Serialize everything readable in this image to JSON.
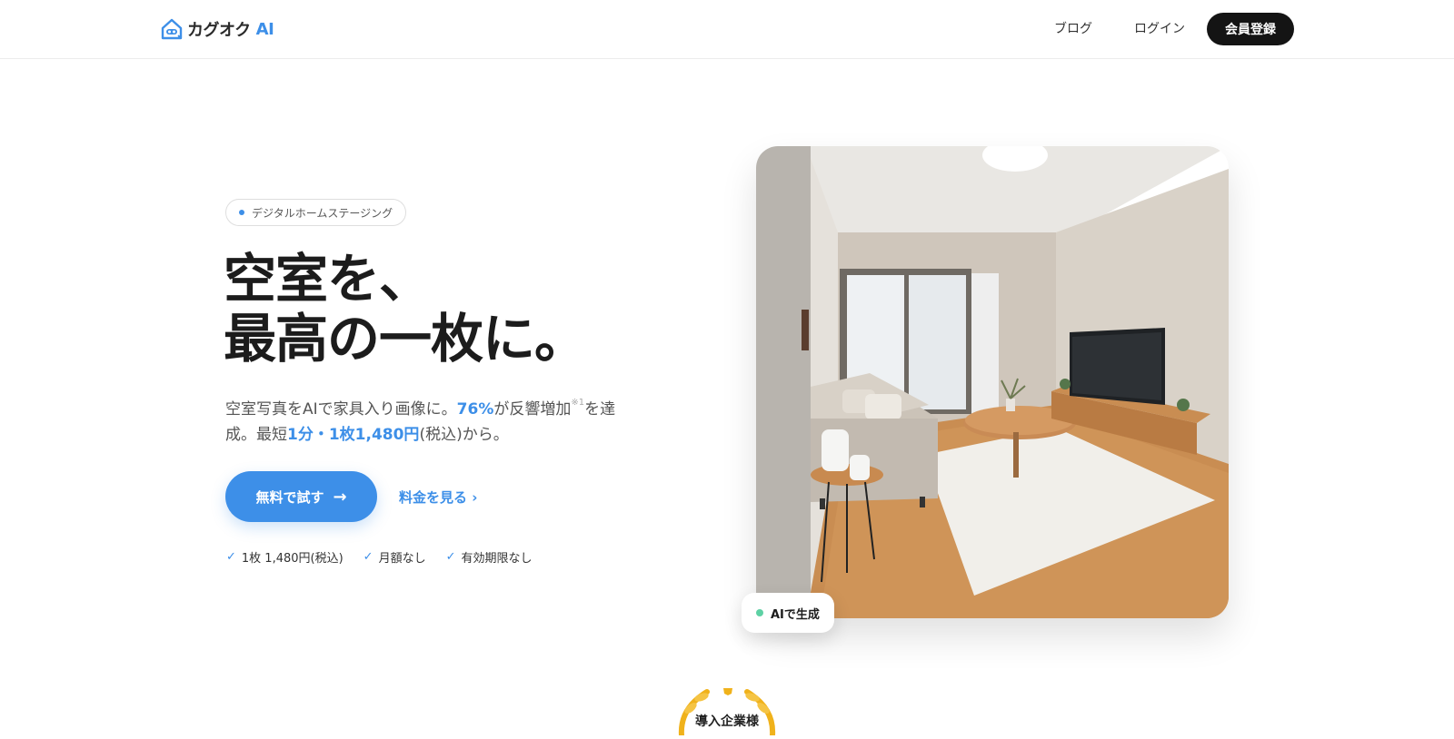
{
  "header": {
    "logo_text": "カグオク",
    "logo_ai": "AI",
    "nav": {
      "blog": "ブログ",
      "login": "ログイン",
      "signup": "会員登録"
    }
  },
  "hero": {
    "badge": "デジタルホームステージング",
    "headline_line1": "空室を、",
    "headline_line2": "最高の一枚に。",
    "lead": {
      "part1": "空室写真をAIで家具入り画像に。",
      "stat": "76%",
      "part2": "が反響増加",
      "note": "※1",
      "part3": "を達成。最短",
      "price_highlight": "1分・1枚1,480円",
      "part4": "(税込)から。"
    },
    "cta_primary": "無料で試す",
    "cta_primary_icon": "arrow-right-icon",
    "cta_secondary": "料金を見る ›",
    "features": [
      "1枚 1,480円(税込)",
      "月額なし",
      "有効期限なし"
    ],
    "image_chip": "AIで生成",
    "award_text": "導入企業様"
  },
  "colors": {
    "accent": "#3d8fe8",
    "dark": "#141414",
    "chip_dot": "#5ed1a4"
  }
}
